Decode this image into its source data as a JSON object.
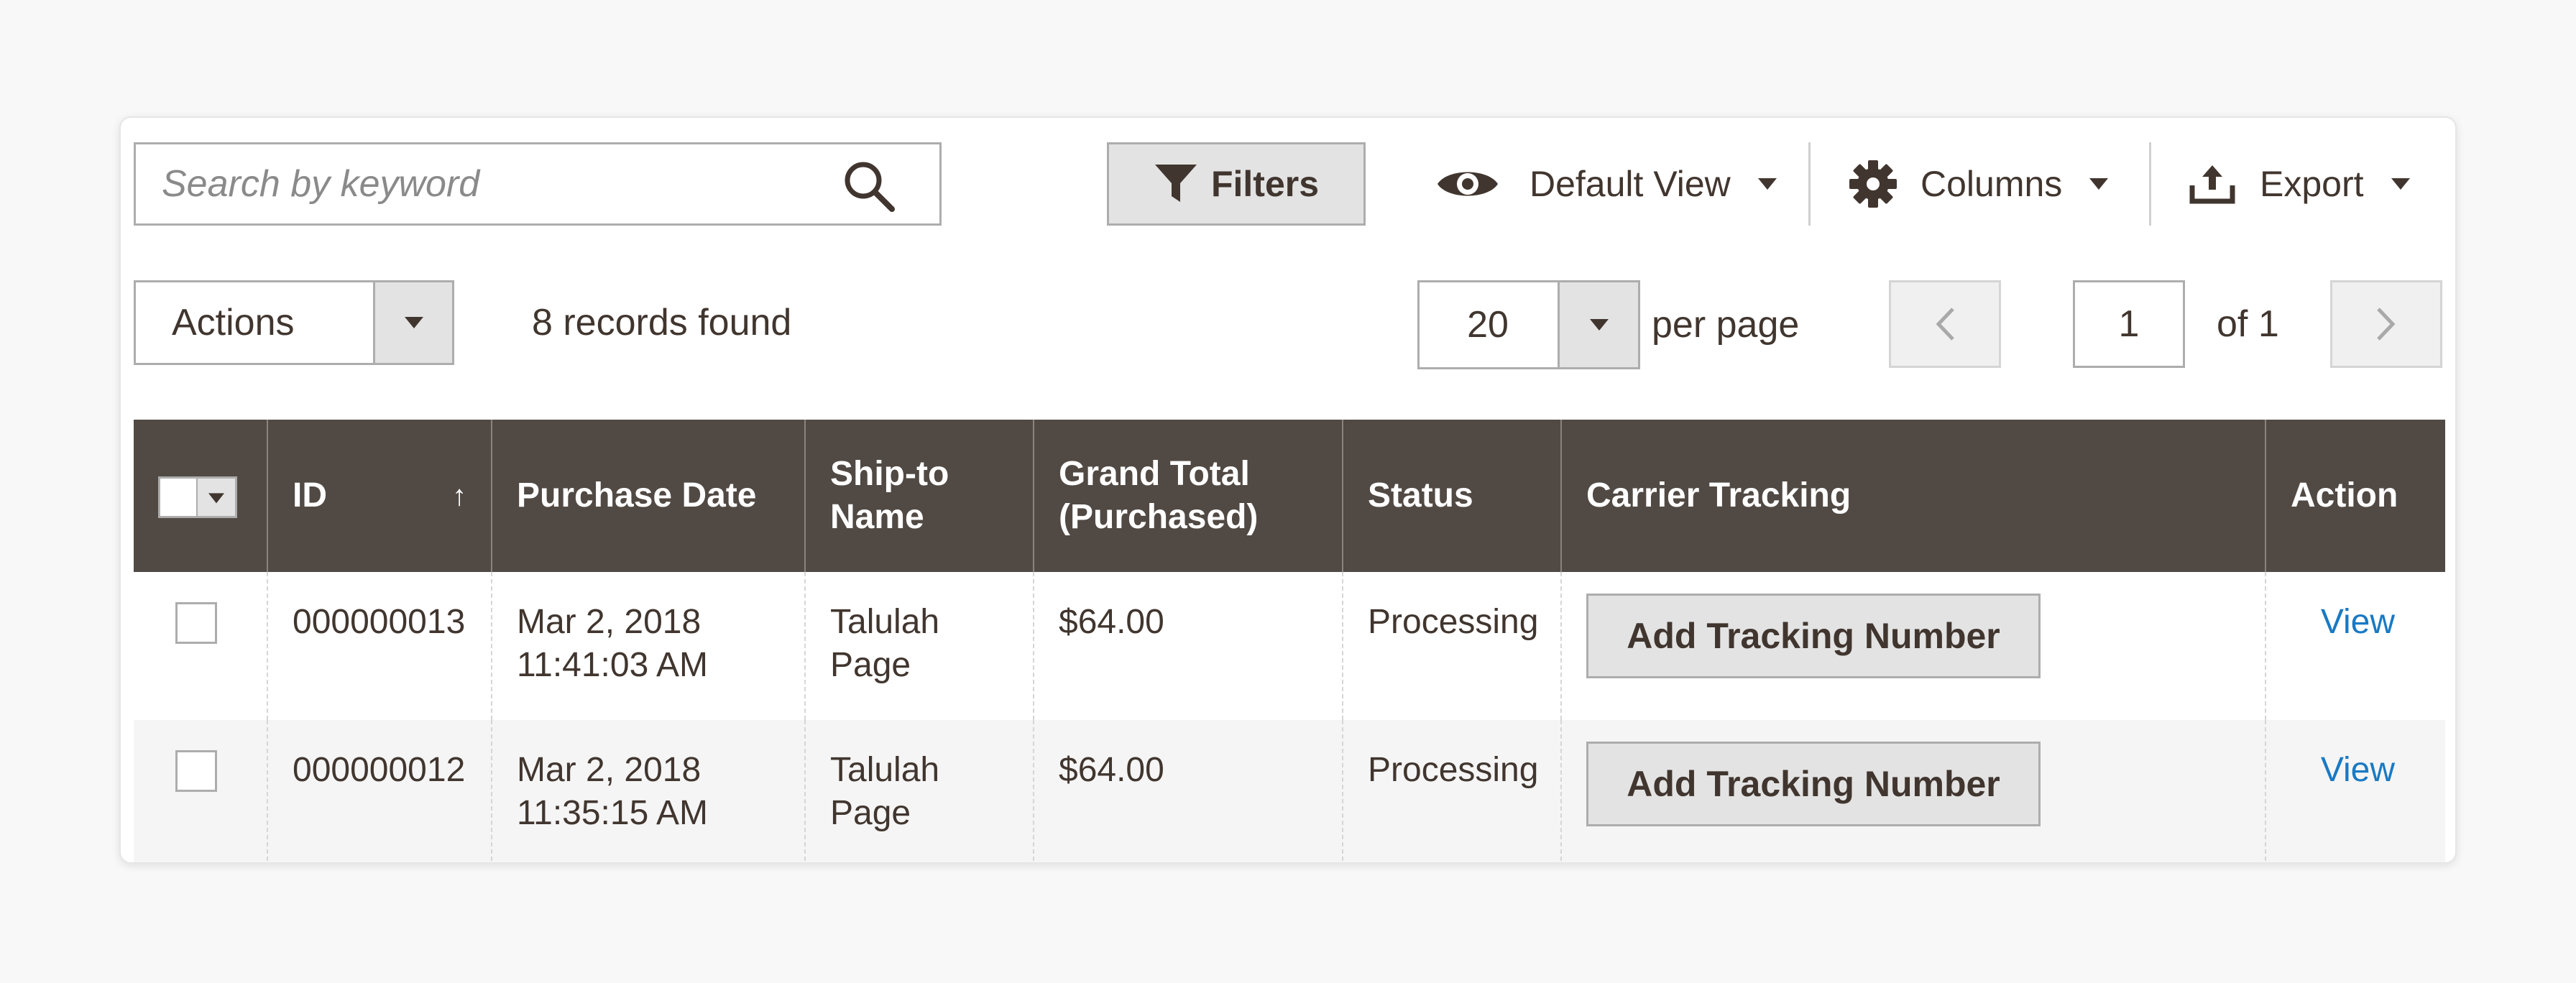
{
  "toolbar": {
    "search_placeholder": "Search by keyword",
    "filters_label": "Filters",
    "default_view_label": "Default View",
    "columns_label": "Columns",
    "export_label": "Export"
  },
  "massactions": {
    "actions_label": "Actions",
    "records_found": "8 records found"
  },
  "pagination": {
    "per_page_value": "20",
    "per_page_label": "per page",
    "current_page": "1",
    "of_label": "of 1"
  },
  "grid": {
    "columns": [
      "ID",
      "Purchase Date",
      "Ship-to Name",
      "Grand Total (Purchased)",
      "Status",
      "Carrier Tracking",
      "Action"
    ],
    "header_id": "ID",
    "sort_indicator": "↑",
    "header_purchase_date": "Purchase Date",
    "header_ship_to_1": "Ship-to",
    "header_ship_to_2": "Name",
    "header_grand_total_1": "Grand Total",
    "header_grand_total_2": "(Purchased)",
    "header_status": "Status",
    "header_carrier_tracking": "Carrier Tracking",
    "header_action": "Action",
    "rows": [
      {
        "id": "000000013",
        "date_line1": "Mar 2, 2018",
        "date_line2": "11:41:03 AM",
        "ship_line1": "Talulah",
        "ship_line2": "Page",
        "grand_total": "$64.00",
        "status": "Processing",
        "tracking_button": "Add Tracking Number",
        "action": "View"
      },
      {
        "id": "000000012",
        "date_line1": "Mar 2, 2018",
        "date_line2": "11:35:15 AM",
        "ship_line1": "Talulah",
        "ship_line2": "Page",
        "grand_total": "$64.00",
        "status": "Processing",
        "tracking_button": "Add Tracking Number",
        "action": "View"
      }
    ]
  },
  "icons": {
    "search": "search-icon",
    "filter": "filter-icon",
    "eye": "eye-icon",
    "gear": "gear-icon",
    "export": "export-icon",
    "chevron_left": "chevron-left-icon",
    "chevron_right": "chevron-right-icon"
  },
  "colors": {
    "header_bg": "#514943",
    "text": "#41362f",
    "link": "#1979c3",
    "button_bg": "#e3e3e3",
    "border": "#adadad"
  }
}
